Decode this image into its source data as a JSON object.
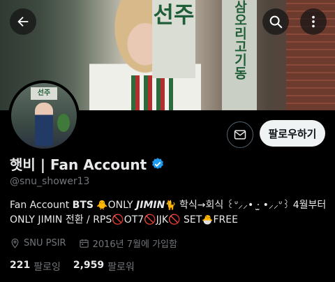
{
  "profile": {
    "display_name": "햇비 | Fan Account",
    "handle": "@snu_shower13",
    "follow_label": "팔로우하기",
    "bio_line1_a": "Fan Account ",
    "bio_line1_bts": "BTS",
    "bio_line1_chick": "🐥",
    "bio_line1_only": "ONLY ",
    "bio_line1_jimin": "JIMIN",
    "bio_line1_cat": "🐈",
    "bio_line1_b": " 학식→회식 ꒰ᐡ⸝⸝• ·̫ •⸝⸝ᐡ꒱ 4월부터",
    "bio_line2_a": "ONLY JIMIN 전환 / RPS",
    "bio_line2_b": "OT7",
    "bio_line2_c": "JJK",
    "bio_line2_d": "  SET",
    "bio_line2_e": "FREE",
    "location": "SNU PSIR",
    "joined": "2016년 7월에 가입함",
    "following_count": "221",
    "following_label": "팔로잉",
    "followers_count": "2,959",
    "followers_label": "팔로워"
  },
  "banner_text": {
    "sign_left": "선주",
    "sign_right": "삼오리고기동"
  },
  "avatar_sign": "선주",
  "icons": {
    "back": "back-arrow-icon",
    "search": "search-icon",
    "more": "more-vertical-icon",
    "mail": "mail-icon",
    "verified": "verified-badge-icon",
    "location": "location-icon",
    "calendar": "calendar-icon",
    "prohibited": "prohibited-icon"
  },
  "colors": {
    "background": "#000000",
    "text": "#e7e9ea",
    "secondary": "#71767b",
    "verified": "#1d9bf0",
    "follow_bg": "#eff3f4",
    "prohibited": "#e0245e"
  }
}
